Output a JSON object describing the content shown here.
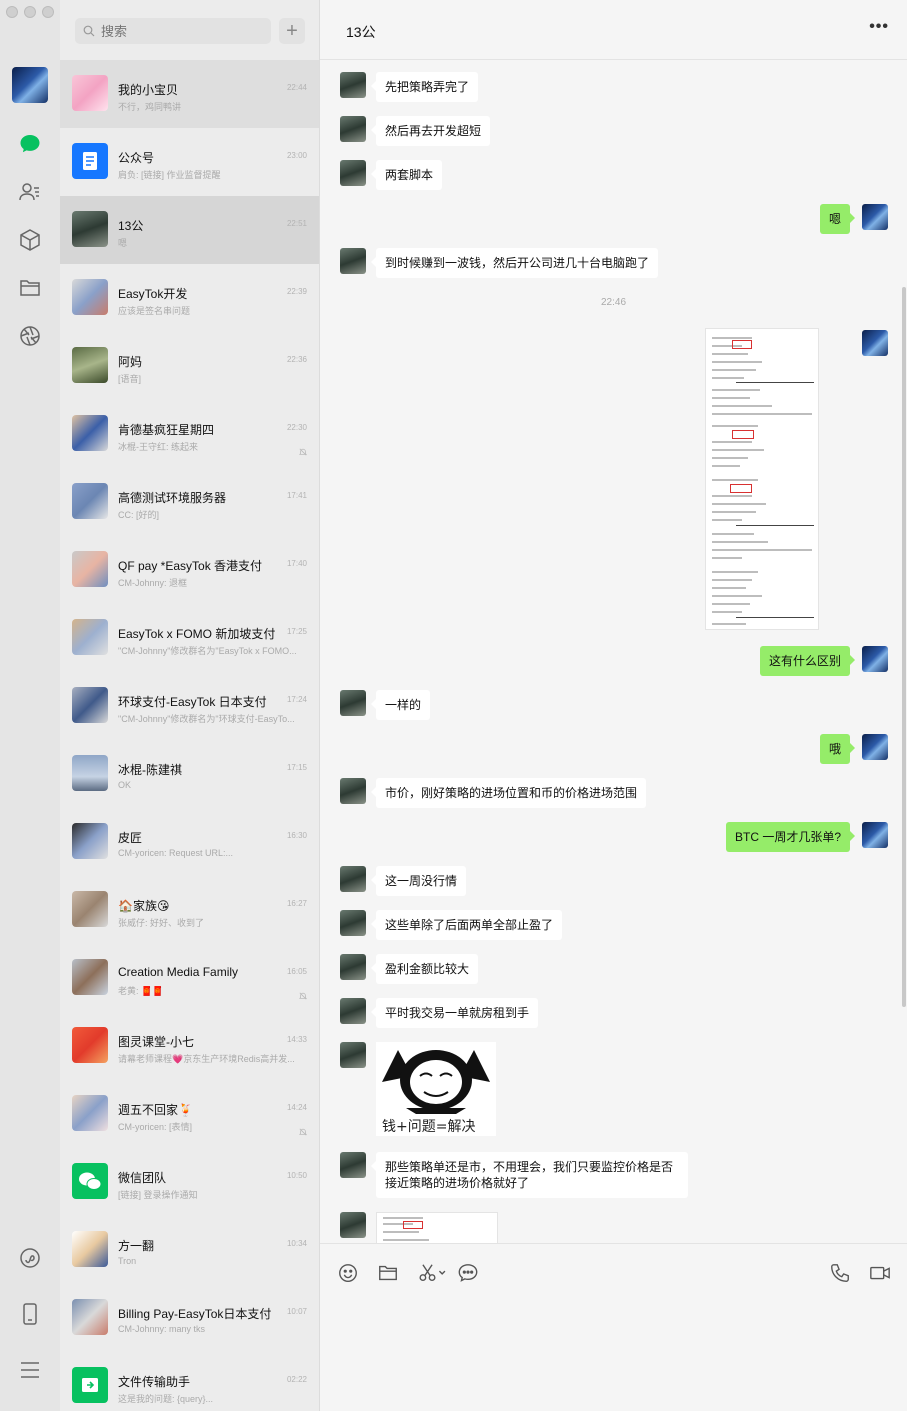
{
  "window": {
    "title": "13公"
  },
  "search": {
    "placeholder": "搜索"
  },
  "chats": [
    {
      "name": "我的小宝贝",
      "preview": "不行，鸡同鸭讲",
      "time": "22:44",
      "muted": false
    },
    {
      "name": "公众号",
      "preview": "肩负: [链接] 作业监督提醒",
      "time": "23:00",
      "muted": false
    },
    {
      "name": "13公",
      "preview": "嗯",
      "time": "22:51",
      "muted": false
    },
    {
      "name": "EasyTok开发",
      "preview": "应该是签名串问题",
      "time": "22:39",
      "muted": false
    },
    {
      "name": "阿妈",
      "preview": "[语音]",
      "time": "22:36",
      "muted": false
    },
    {
      "name": "肯德基疯狂星期四",
      "preview": "冰棍-王守红: 练起来",
      "time": "22:30",
      "muted": true
    },
    {
      "name": "高德测试环境服务器",
      "preview": "CC: [好的]",
      "time": "17:41",
      "muted": false
    },
    {
      "name": "QF pay *EasyTok 香港支付",
      "preview": "CM-Johnny: 退框",
      "time": "17:40",
      "muted": false
    },
    {
      "name": "EasyTok x FOMO 新加坡支付",
      "preview": "\"CM-Johnny\"修改群名为\"EasyTok x FOMO...",
      "time": "17:25",
      "muted": false
    },
    {
      "name": "环球支付-EasyTok 日本支付",
      "preview": "\"CM-Johnny\"修改群名为\"环球支付-EasyTo...",
      "time": "17:24",
      "muted": false
    },
    {
      "name": "冰棍-陈建祺",
      "preview": "OK",
      "time": "17:15",
      "muted": false
    },
    {
      "name": "皮匠",
      "preview": "CM-yoricen: Request URL:...",
      "time": "16:30",
      "muted": false
    },
    {
      "name": "🏠家族😘",
      "preview": "张威仔: 好好、收到了",
      "time": "16:27",
      "muted": false
    },
    {
      "name": "Creation Media Family",
      "preview": "老黄: 🧧🧧",
      "time": "16:05",
      "muted": true
    },
    {
      "name": "图灵课堂-小七",
      "preview": "请幕老师课程💗京东生产环境Redis高并发...",
      "time": "14:33",
      "muted": false
    },
    {
      "name": "週五不回家🍹",
      "preview": "CM-yoricen: [表情]",
      "time": "14:24",
      "muted": true
    },
    {
      "name": "微信团队",
      "preview": "[链接] 登录操作通知",
      "time": "10:50",
      "muted": false
    },
    {
      "name": "方一翻",
      "preview": "Tron",
      "time": "10:34",
      "muted": false
    },
    {
      "name": "Billing Pay-EasyTok日本支付",
      "preview": "CM-Johnny: many tks",
      "time": "10:07",
      "muted": false
    },
    {
      "name": "文件传输助手",
      "preview": "这是我的问题: {query}...",
      "time": "02:22",
      "muted": false
    }
  ],
  "messages": [
    {
      "from": "them",
      "text": "先把策略弄完了"
    },
    {
      "from": "them",
      "text": "然后再去开发超短"
    },
    {
      "from": "them",
      "text": "两套脚本"
    },
    {
      "from": "me",
      "text": "嗯"
    },
    {
      "from": "them",
      "text": "到时候赚到一波钱，然后开公司进几十台电脑跑了"
    },
    {
      "timestamp": "22:46"
    },
    {
      "from": "me",
      "type": "image"
    },
    {
      "from": "me",
      "text": "这有什么区别"
    },
    {
      "from": "them",
      "text": "一样的"
    },
    {
      "from": "me",
      "text": "哦"
    },
    {
      "from": "them",
      "text": "市价，刚好策略的进场位置和币的价格进场范围"
    },
    {
      "from": "me",
      "text": "BTC 一周才几张单?"
    },
    {
      "from": "them",
      "text": "这一周没行情"
    },
    {
      "from": "them",
      "text": "这些单除了后面两单全部止盈了"
    },
    {
      "from": "them",
      "text": "盈利金额比较大"
    },
    {
      "from": "them",
      "text": "平时我交易一单就房租到手"
    },
    {
      "from": "them",
      "type": "sticker",
      "caption": "钱+问题=解决"
    },
    {
      "from": "them",
      "text": "那些策略单还是市，不用理会，我们只要监控价格是否接近策略的进场价格就好了"
    },
    {
      "from": "them",
      "type": "image"
    }
  ],
  "colors": {
    "out_bubble": "#95ec69",
    "in_bubble": "#ffffff",
    "wechat_green": "#07c160"
  }
}
